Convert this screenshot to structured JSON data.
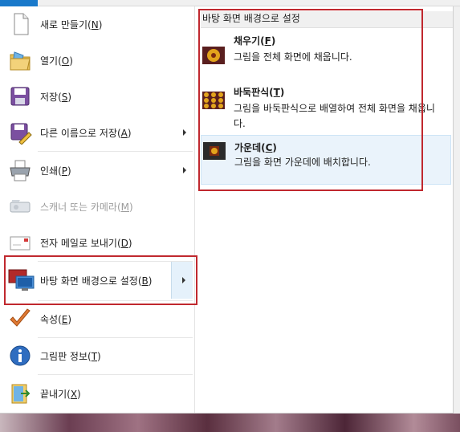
{
  "menu": {
    "items": [
      {
        "label": "새로 만들기(",
        "mnemonic": "N",
        "suffix": ")",
        "icon": "new-document-icon"
      },
      {
        "label": "열기(",
        "mnemonic": "O",
        "suffix": ")",
        "icon": "open-folder-icon"
      },
      {
        "label": "저장(",
        "mnemonic": "S",
        "suffix": ")",
        "icon": "save-disk-icon"
      },
      {
        "label": "다른 이름으로 저장(",
        "mnemonic": "A",
        "suffix": ")",
        "icon": "save-as-icon"
      },
      {
        "label": "인쇄(",
        "mnemonic": "P",
        "suffix": ")",
        "icon": "printer-icon"
      },
      {
        "label": "스캐너 또는 카메라(",
        "mnemonic": "M",
        "suffix": ")",
        "icon": "scanner-camera-icon"
      },
      {
        "label": "전자 메일로 보내기(",
        "mnemonic": "D",
        "suffix": ")",
        "icon": "email-icon"
      },
      {
        "label": "바탕 화면 배경으로 설정(",
        "mnemonic": "B",
        "suffix": ")",
        "icon": "desktop-background-icon"
      },
      {
        "label": "속성(",
        "mnemonic": "E",
        "suffix": ")",
        "icon": "checkmark-icon"
      },
      {
        "label": "그림판 정보(",
        "mnemonic": "T",
        "suffix": ")",
        "icon": "info-icon"
      },
      {
        "label": "끝내기(",
        "mnemonic": "X",
        "suffix": ")",
        "icon": "exit-icon"
      }
    ]
  },
  "submenu": {
    "title": "바탕 화면 배경으로 설정",
    "options": [
      {
        "name": "채우기(",
        "mnemonic": "F",
        "suffix": ")",
        "description": "그림을 전체 화면에 채웁니다.",
        "icon": "fill-icon"
      },
      {
        "name": "바둑판식(",
        "mnemonic": "T",
        "suffix": ")",
        "description": "그림을 바둑판식으로 배열하여 전체 화면을 채웁니다.",
        "icon": "tile-icon"
      },
      {
        "name": "가운데(",
        "mnemonic": "C",
        "suffix": ")",
        "description": "그림을 화면 가운데에 배치합니다.",
        "icon": "center-icon"
      }
    ]
  },
  "colors": {
    "accent": "#1979ca",
    "highlight_border": "#c0282e",
    "hover_bg": "#e5f1fb"
  }
}
